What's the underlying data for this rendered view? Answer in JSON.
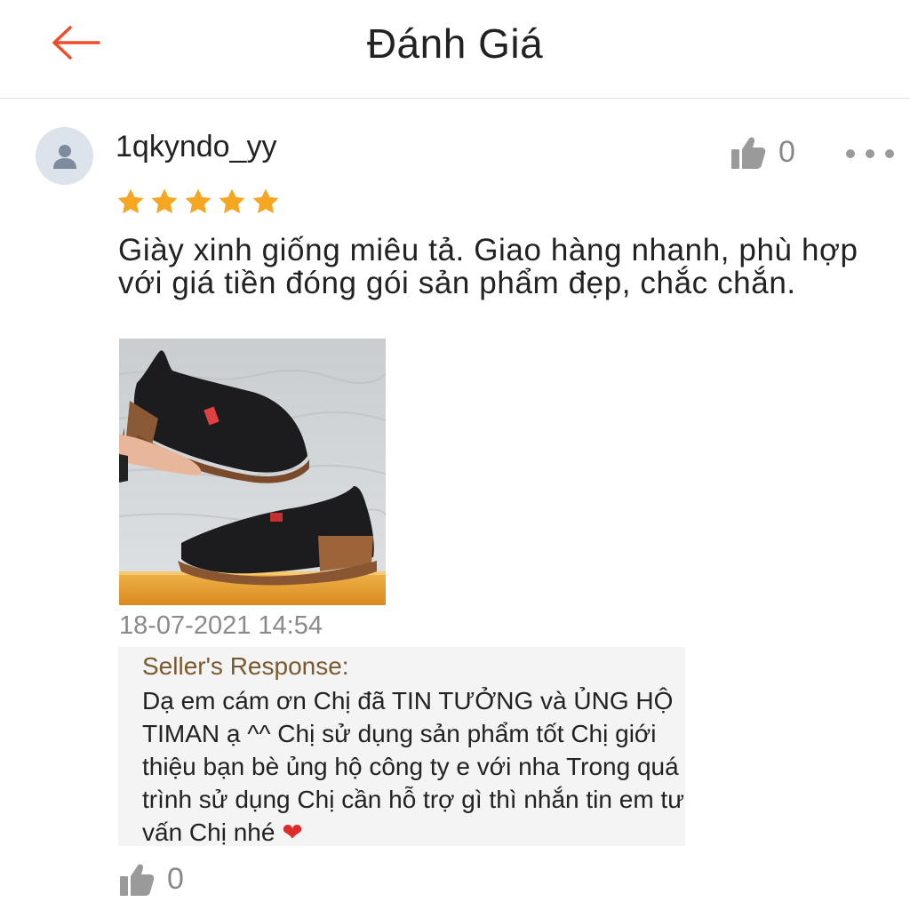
{
  "header": {
    "title": "Đánh Giá",
    "back_icon": "arrow-left-icon",
    "accent": "#ee4d2d"
  },
  "review": {
    "username": "1qkyndo_yy",
    "like_count": "0",
    "rating": 5,
    "star_color": "#f5a623",
    "text": "Giày xinh giống miêu tả. Giao hàng nhanh, phù hợp với giá tiền đóng gói sản phẩm đẹp, chắc chắn.",
    "timestamp": "18-07-2021 14:54"
  },
  "seller_response": {
    "title": "Seller's Response:",
    "text": "Dạ em cám ơn  Chị  đã TIN TƯỞNG và ỦNG HỘ TIMAN ạ ^^  Chị sử dụng sản phẩm tốt  Chị  giới thiệu bạn bè ủng hộ công ty e với nha Trong quá trình sử dụng  Chị  cần hỗ trợ gì thì nhắn tin em tư vấn  Chị  nhé",
    "emoji": "❤"
  },
  "response_like_count": "0"
}
